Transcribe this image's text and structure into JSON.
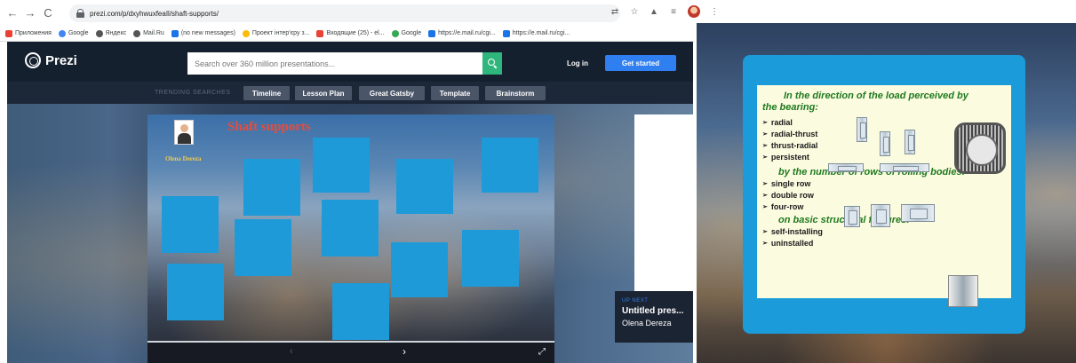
{
  "browser": {
    "url": "prezi.com/p/dxyhwuxfeaIl/shaft-supports/",
    "bookmarks": [
      "Приложения",
      "Google",
      "Яндекс",
      "Mail.Ru",
      "(no new messages)",
      "Проект інтер'єру з...",
      "Входящие (25) - el...",
      "Google",
      "https://e.mail.ru/cgi...",
      "https://e.mail.ru/cgi..."
    ]
  },
  "prezi": {
    "logo": "Prezi",
    "search_placeholder": "Search over 360 million presentations...",
    "login": "Log in",
    "get_started": "Get started",
    "trending_label": "TRENDING SEARCHES",
    "trending": [
      "Timeline",
      "Lesson Plan",
      "Great Gatsby",
      "Template",
      "Brainstorm"
    ],
    "presentation": {
      "author_name": "Olena Dereza",
      "title": "Shaft supports"
    },
    "up_next": {
      "label": "UP NEXT",
      "title": "Untitled pres...",
      "author": "Olena Dereza"
    }
  },
  "slide": {
    "heading1": "In the direction of the load perceived by",
    "heading1_cont": "the bearing:",
    "list1": [
      "radial",
      "radial-thrust",
      "thrust-radial",
      "persistent"
    ],
    "heading2": "by the number of rows of rolling bodies:",
    "list2": [
      "single row",
      "double row",
      "four-row"
    ],
    "heading3": "on basic structural features:",
    "list3": [
      "self-installing",
      "uninstalled"
    ]
  },
  "colors": {
    "prezi_header": "#15202f",
    "prezi_blue": "#2f7ff0",
    "search_green": "#2fb67c",
    "tile_blue": "#1e9ad8",
    "slide_heading_green": "#1e7a1e",
    "slide_bg_cream": "#fbfbe0",
    "title_red": "#e74c3c"
  }
}
